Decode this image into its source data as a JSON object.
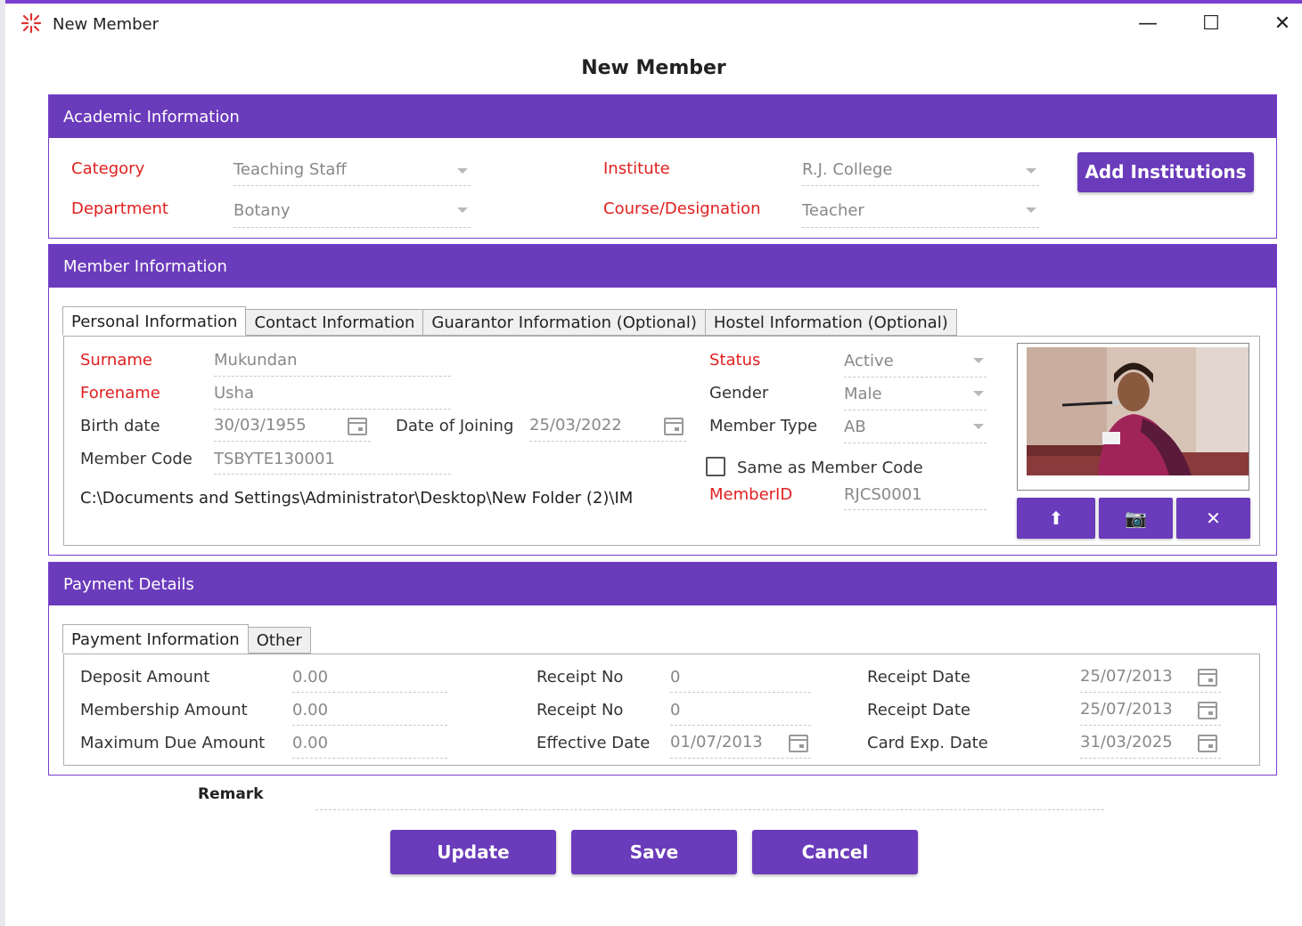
{
  "window": {
    "title": "New Member",
    "minimize": "—",
    "maximize": "☐",
    "close": "✕"
  },
  "heading": "New Member",
  "academic": {
    "header": "Academic Information",
    "category_label": "Category",
    "category_value": "Teaching Staff",
    "department_label": "Department",
    "department_value": "Botany",
    "institute_label": "Institute",
    "institute_value": "R.J. College",
    "course_label": "Course/Designation",
    "course_value": "Teacher",
    "add_institutions": "Add Institutions"
  },
  "member": {
    "header": "Member Information",
    "tabs": [
      "Personal Information",
      "Contact Information",
      "Guarantor Information (Optional)",
      "Hostel Information (Optional)"
    ],
    "surname_label": "Surname",
    "surname_value": "Mukundan",
    "forename_label": "Forename",
    "forename_value": "Usha",
    "birth_label": "Birth date",
    "birth_value": "30/03/1955",
    "joining_label": "Date of Joining",
    "joining_value": "25/03/2022",
    "code_label": "Member Code",
    "code_value": "TSBYTE130001",
    "path": "C:\\Documents and Settings\\Administrator\\Desktop\\New Folder (2)\\IM",
    "status_label": "Status",
    "status_value": "Active",
    "gender_label": "Gender",
    "gender_value": "Male",
    "type_label": "Member Type",
    "type_value": "AB",
    "same_code_label": "Same as Member Code",
    "memberid_label": "MemberID",
    "memberid_value": "RJCS0001",
    "photo_upload": "⬆",
    "photo_camera": "📷",
    "photo_remove": "✕"
  },
  "payment": {
    "header": "Payment Details",
    "tabs": [
      "Payment Information",
      "Other"
    ],
    "deposit_label": "Deposit Amount",
    "deposit_value": "0.00",
    "membership_label": "Membership Amount",
    "membership_value": "0.00",
    "maxdue_label": "Maximum Due Amount",
    "maxdue_value": "0.00",
    "receipt1_label": "Receipt No",
    "receipt1_value": "0",
    "receipt2_label": "Receipt No",
    "receipt2_value": "0",
    "effective_label": "Effective Date",
    "effective_value": "01/07/2013",
    "rdate1_label": "Receipt Date",
    "rdate1_value": "25/07/2013",
    "rdate2_label": "Receipt Date",
    "rdate2_value": "25/07/2013",
    "cardexp_label": "Card Exp. Date",
    "cardexp_value": "31/03/2025"
  },
  "remark_label": "Remark",
  "buttons": {
    "update": "Update",
    "save": "Save",
    "cancel": "Cancel"
  },
  "colors": {
    "accent": "#6a3bbb",
    "required": "#e02020"
  }
}
